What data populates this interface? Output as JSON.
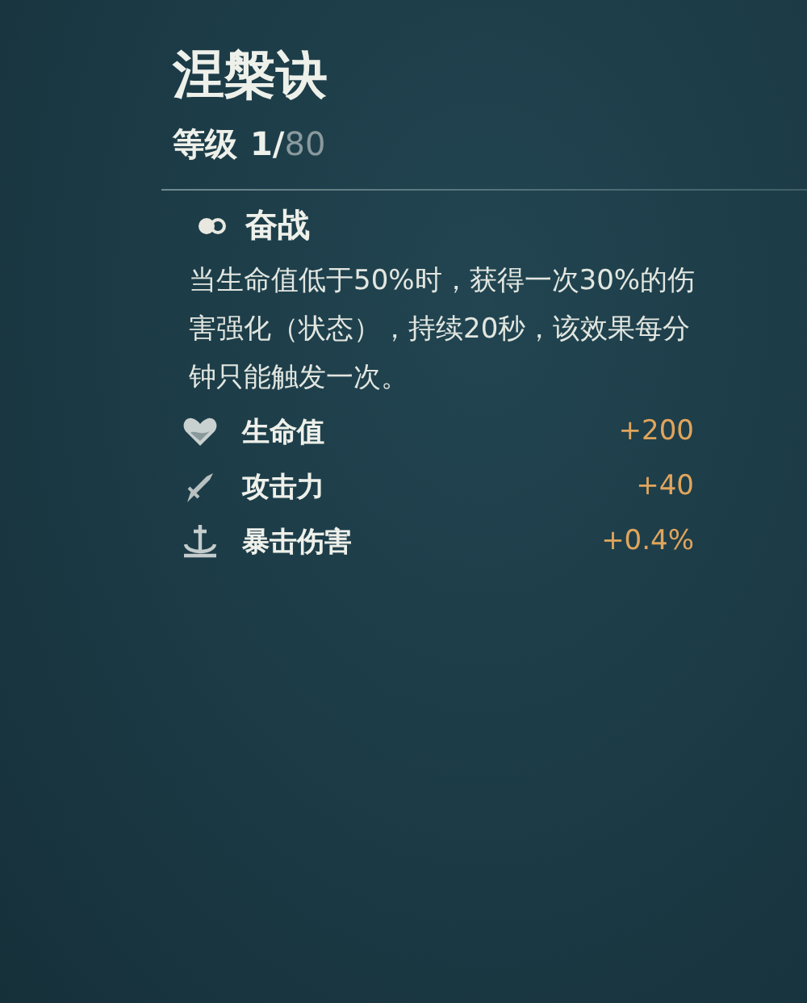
{
  "title": "涅槃诀",
  "level": {
    "label": "等级",
    "current": "1/",
    "max": "80"
  },
  "skill": {
    "name": "奋战",
    "description": "当生命值低于50%时，获得一次30%的伤害强化（状态），持续20秒，该效果每分钟只能触发一次。"
  },
  "stats": [
    {
      "kind": "heart",
      "label": "生命值",
      "value": "+200"
    },
    {
      "kind": "sword",
      "label": "攻击力",
      "value": "+40"
    },
    {
      "kind": "anchor",
      "label": "暴击伤害",
      "value": "+0.4%"
    }
  ]
}
